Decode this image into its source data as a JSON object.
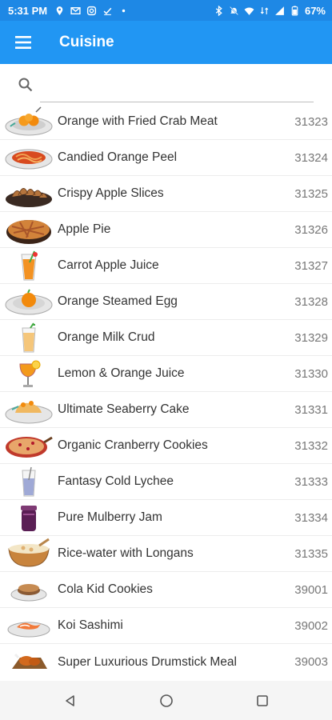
{
  "status_bar": {
    "time": "5:31 PM",
    "battery": "67%",
    "left_icons": [
      "location-icon",
      "gmail-icon",
      "instagram-icon",
      "check-icon",
      "dot-icon"
    ],
    "right_icons": [
      "bluetooth-icon",
      "mute-icon",
      "wifi-icon",
      "data-icon",
      "signal-icon",
      "battery-icon"
    ]
  },
  "app_bar": {
    "title": "Cuisine",
    "menu_icon": "hamburger-menu-icon",
    "color": "#2196f3"
  },
  "search": {
    "value": "",
    "placeholder": "",
    "icon": "search-icon"
  },
  "items": [
    {
      "name": "Orange with Fried Crab Meat",
      "id": "31323",
      "icon": "orange-crab-dish-icon"
    },
    {
      "name": "Candied Orange Peel",
      "id": "31324",
      "icon": "candied-peel-dish-icon"
    },
    {
      "name": "Crispy Apple Slices",
      "id": "31325",
      "icon": "apple-slices-dish-icon"
    },
    {
      "name": "Apple Pie",
      "id": "31326",
      "icon": "apple-pie-icon"
    },
    {
      "name": "Carrot Apple Juice",
      "id": "31327",
      "icon": "carrot-juice-glass-icon"
    },
    {
      "name": "Orange Steamed Egg",
      "id": "31328",
      "icon": "steamed-egg-dish-icon"
    },
    {
      "name": "Orange Milk Crud",
      "id": "31329",
      "icon": "milk-crud-glass-icon"
    },
    {
      "name": "Lemon & Orange Juice",
      "id": "31330",
      "icon": "lemon-orange-juice-glass-icon"
    },
    {
      "name": "Ultimate Seaberry Cake",
      "id": "31331",
      "icon": "seaberry-cake-dish-icon"
    },
    {
      "name": "Organic Cranberry Cookies",
      "id": "31332",
      "icon": "cranberry-cookies-pan-icon"
    },
    {
      "name": "Fantasy Cold Lychee",
      "id": "31333",
      "icon": "lychee-drink-glass-icon"
    },
    {
      "name": "Pure Mulberry Jam",
      "id": "31334",
      "icon": "mulberry-jam-jar-icon"
    },
    {
      "name": "Rice-water with Longans",
      "id": "31335",
      "icon": "rice-water-bowl-icon"
    },
    {
      "name": "Cola Kid Cookies",
      "id": "39001",
      "icon": "cola-cookies-plate-icon"
    },
    {
      "name": "Koi Sashimi",
      "id": "39002",
      "icon": "koi-sashimi-plate-icon"
    },
    {
      "name": "Super Luxurious Drumstick Meal",
      "id": "39003",
      "icon": "drumstick-meal-icon"
    }
  ],
  "nav_bar": {
    "icons": [
      "back-icon",
      "home-icon",
      "recents-icon"
    ]
  }
}
